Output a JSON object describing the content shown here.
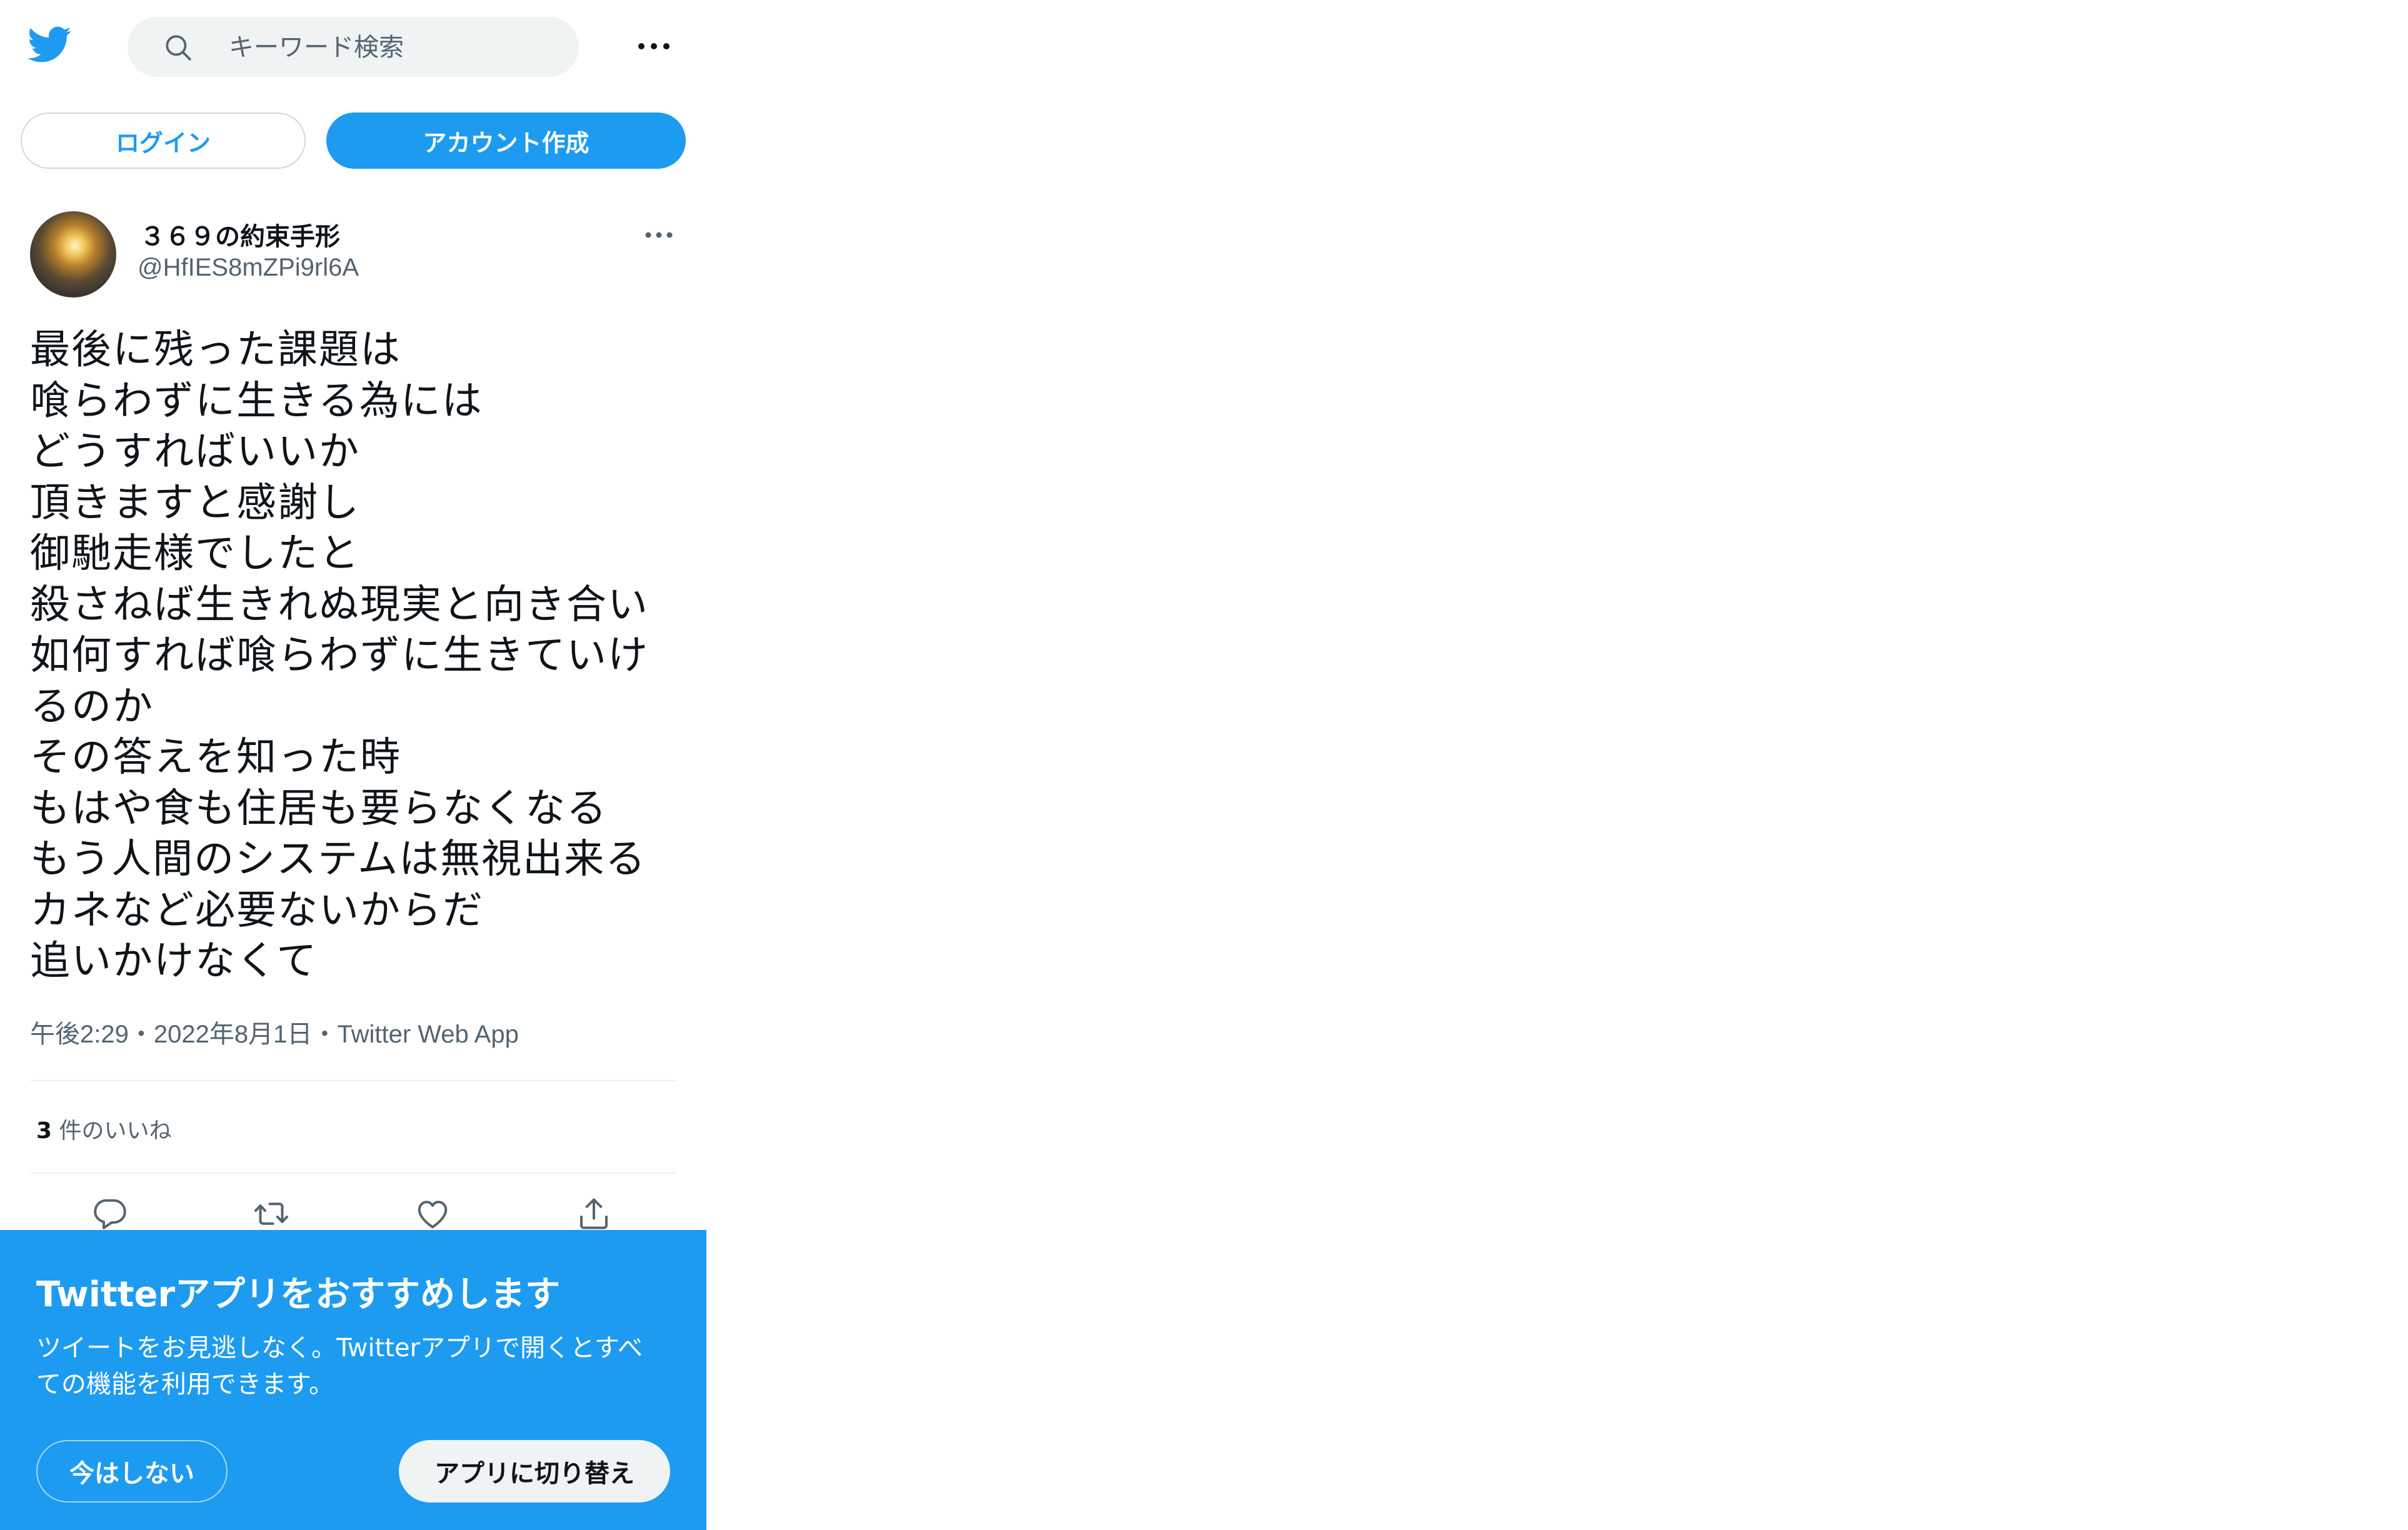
{
  "header": {
    "search_placeholder": "キーワード検索",
    "icons": {
      "logo": "twitter-bird-icon",
      "search": "search-icon",
      "more": "more-horizontal-icon"
    }
  },
  "auth": {
    "login_label": "ログイン",
    "signup_label": "アカウント作成"
  },
  "tweet": {
    "display_name": "３６９の約束手形",
    "handle": "@HfIES8mZPi9rl6A",
    "text_lines": [
      "最後に残った課題は",
      "喰らわずに生きる為には",
      "どうすればいいか",
      "頂きますと感謝し",
      "御馳走様でしたと",
      "殺さねば生きれぬ現実と向き合い",
      "如何すれば喰らわずに生きていけ",
      "るのか",
      "その答えを知った時",
      "もはや食も住居も要らなくなる",
      "もう人間のシステムは無視出来る",
      "カネなど必要ないからだ",
      "追いかけなくて"
    ],
    "time": "午後2:29",
    "separator_1": "・",
    "date": "2022年8月1日",
    "separator_2": "・",
    "source": "Twitter Web App",
    "likes_count": "3",
    "likes_label": " 件のいいね",
    "actions": [
      "reply-icon",
      "retweet-icon",
      "like-icon",
      "share-icon"
    ]
  },
  "banner": {
    "title": "Twitterアプリをおすすめします",
    "desc_line_1": "ツイートをお見逃しなく。Twitterアプリで開くとすべ",
    "desc_line_2": "ての機能を利用できます。",
    "not_now_label": "今はしない",
    "switch_label": "アプリに切り替え"
  },
  "colors": {
    "brand_blue": "#1d9bf0",
    "text_primary": "#0f1419",
    "text_secondary": "#536471",
    "search_bg": "#eff3f4"
  }
}
